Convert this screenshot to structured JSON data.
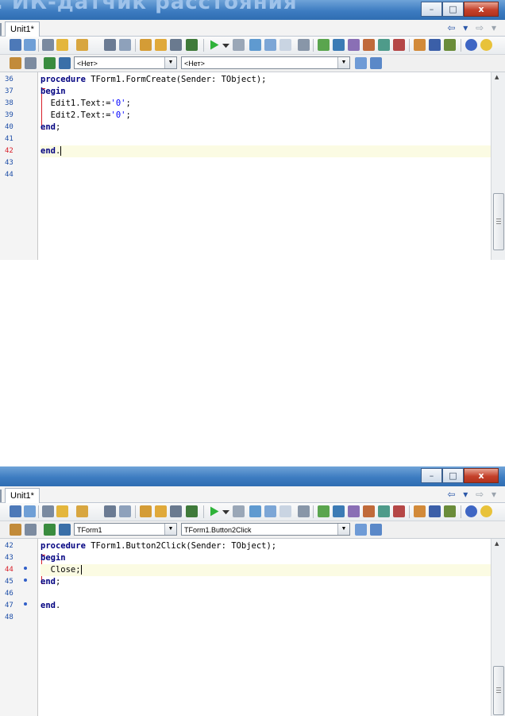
{
  "window1": {
    "title": ". ИК-датчик расстояния",
    "tab_label": "Unit1*",
    "combo_left": "<Нет>",
    "combo_right": "<Нет>",
    "line_numbers": [
      "36",
      "37",
      "38",
      "39",
      "40",
      "41",
      "42",
      "43",
      "44"
    ],
    "current_line_number": "42",
    "code": {
      "l1_kw": "procedure",
      "l1_rest": " TForm1.FormCreate(Sender: TObject);",
      "l2_kw": "begin",
      "l3_a": "  Edit1.Text:=",
      "l3_str": "'0'",
      "l3_b": ";",
      "l4_a": "  Edit2.Text:=",
      "l4_str": "'0'",
      "l4_b": ";",
      "l5_kw": "end",
      "l5_rest": ";",
      "l7_kw": "end",
      "l7_rest": "."
    }
  },
  "window2": {
    "tab_label": "Unit1*",
    "combo_left": "TForm1",
    "combo_right": "TForm1.Button2Click",
    "line_numbers": [
      "42",
      "43",
      "44",
      "45",
      "46",
      "47",
      "48"
    ],
    "current_line_number": "44",
    "code": {
      "l1_kw": "procedure",
      "l1_rest": " TForm1.Button2Click(Sender: TObject);",
      "l2_kw": "begin",
      "l3_a": "  Close;",
      "l4_kw": "end",
      "l4_rest": ";",
      "l6_kw": "end",
      "l6_rest": "."
    }
  },
  "caption_buttons": {
    "minimize": "–",
    "maximize": "□",
    "close": "x"
  },
  "nav_arrows": {
    "back": "⇦ ▾",
    "forward": "⇨ ▾"
  },
  "colors": {
    "keyword": "#000080",
    "string": "#0000ff",
    "line_number": "#1f4fa8",
    "current_line_bg": "#fbfbe3",
    "title_bar": "#3d7cc1"
  },
  "icons": [
    "toggle-form-unit-icon",
    "view-unit-icon",
    "view-form-icon",
    "new-items-icon",
    "open-icon",
    "save-icon",
    "save-all-icon",
    "open-project-icon",
    "add-to-project-icon",
    "remove-from-project-icon",
    "help-icon",
    "run-icon",
    "run-dropdown-icon",
    "pause-icon",
    "trace-into-icon",
    "step-over-icon",
    "breakpoint-icon",
    "component-palette-icon"
  ]
}
